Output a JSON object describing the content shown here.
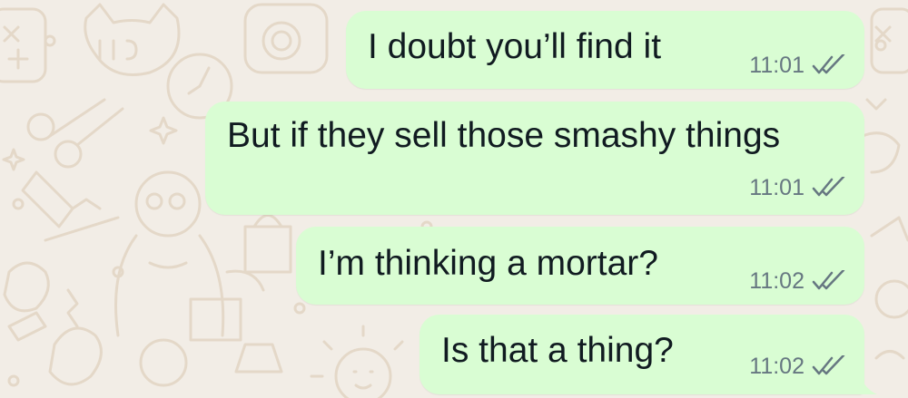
{
  "colors": {
    "background": "#f2ede6",
    "outgoing_bubble": "#d9fdd3",
    "message_text": "#111b21",
    "timestamp_text": "#667781",
    "read_tick": "#667781"
  },
  "messages": [
    {
      "text": "I doubt you’ll find it",
      "time": "11:01",
      "status": "read",
      "status_icon": "double-check-icon"
    },
    {
      "text": "But if they sell those smashy things",
      "time": "11:01",
      "status": "read",
      "status_icon": "double-check-icon"
    },
    {
      "text": "I’m thinking a mortar?",
      "time": "11:02",
      "status": "read",
      "status_icon": "double-check-icon"
    },
    {
      "text": "Is that a thing?",
      "time": "11:02",
      "status": "read",
      "status_icon": "double-check-icon"
    }
  ]
}
